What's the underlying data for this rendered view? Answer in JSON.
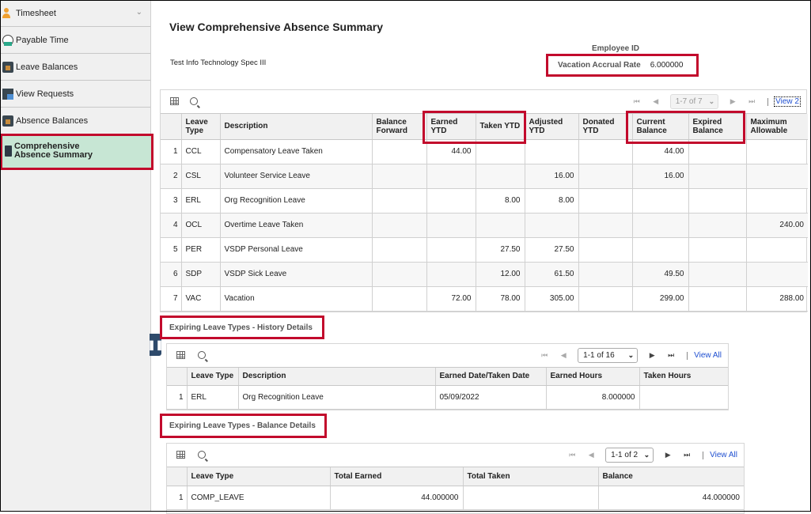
{
  "sidebar": {
    "items": [
      {
        "label": "Timesheet",
        "icon": "person-clock-icon",
        "has_chevron": true
      },
      {
        "label": "Payable Time",
        "icon": "clock-money-icon"
      },
      {
        "label": "Leave Balances",
        "icon": "briefcase-icon"
      },
      {
        "label": "View Requests",
        "icon": "calendar-icon"
      },
      {
        "label": "Absence Balances",
        "icon": "briefcase-icon"
      },
      {
        "label": "Comprehensive Absence Summary",
        "icon": "book-icon",
        "active": true
      }
    ]
  },
  "header": {
    "title": "View Comprehensive Absence Summary",
    "job_title": "Test Info Technology Spec III",
    "employee_id_label": "Employee ID",
    "accrual_label": "Vacation Accrual Rate",
    "accrual_value": "6.000000"
  },
  "summary_grid": {
    "pager": {
      "range": "1-7 of 7",
      "view_link": "View 2"
    },
    "columns": [
      "",
      "Leave Type",
      "Description",
      "Balance Forward",
      "Earned YTD",
      "Taken YTD",
      "Adjusted YTD",
      "Donated YTD",
      "Current Balance",
      "Expired Balance",
      "Maximum Allowable"
    ],
    "rows": [
      [
        "1",
        "CCL",
        "Compensatory Leave Taken",
        "",
        "44.00",
        "",
        "",
        "",
        "44.00",
        "",
        ""
      ],
      [
        "2",
        "CSL",
        "Volunteer Service Leave",
        "",
        "",
        "",
        "16.00",
        "",
        "16.00",
        "",
        ""
      ],
      [
        "3",
        "ERL",
        "Org Recognition Leave",
        "",
        "",
        "8.00",
        "8.00",
        "",
        "",
        "",
        ""
      ],
      [
        "4",
        "OCL",
        "Overtime Leave Taken",
        "",
        "",
        "",
        "",
        "",
        "",
        "",
        "240.00"
      ],
      [
        "5",
        "PER",
        "VSDP Personal Leave",
        "",
        "",
        "27.50",
        "27.50",
        "",
        "",
        "",
        ""
      ],
      [
        "6",
        "SDP",
        "VSDP Sick Leave",
        "",
        "",
        "12.00",
        "61.50",
        "",
        "49.50",
        "",
        ""
      ],
      [
        "7",
        "VAC",
        "Vacation",
        "",
        "72.00",
        "78.00",
        "305.00",
        "",
        "299.00",
        "",
        "288.00"
      ]
    ]
  },
  "history": {
    "title": "Expiring Leave Types - History Details",
    "pager": {
      "range": "1-1 of 16",
      "view_all": "View All"
    },
    "columns": [
      "",
      "Leave Type",
      "Description",
      "Earned Date/Taken Date",
      "Earned Hours",
      "Taken Hours"
    ],
    "rows": [
      [
        "1",
        "ERL",
        "Org Recognition Leave",
        "05/09/2022",
        "8.000000",
        ""
      ]
    ]
  },
  "balance": {
    "title": "Expiring Leave Types - Balance Details",
    "pager": {
      "range": "1-1 of 2",
      "view_all": "View All"
    },
    "columns": [
      "",
      "Leave Type",
      "Total Earned",
      "Total Taken",
      "Balance"
    ],
    "rows": [
      [
        "1",
        "COMP_LEAVE",
        "44.000000",
        "",
        "44.000000"
      ]
    ]
  },
  "colors": {
    "highlight": "#c20a2c",
    "active_bg": "#c7e6d4",
    "link": "#1f4fd0"
  }
}
